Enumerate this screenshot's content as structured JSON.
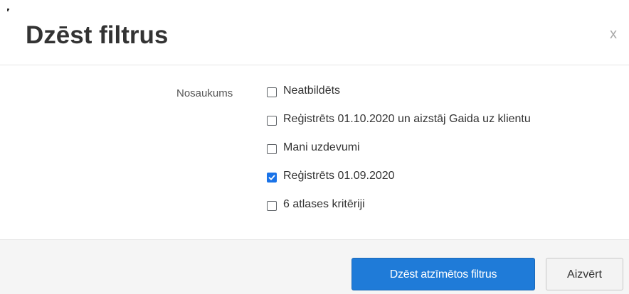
{
  "dialog": {
    "title": "Dzēst filtrus",
    "close_label": "x"
  },
  "form": {
    "field_label": "Nosaukums",
    "options": [
      {
        "label": "Neatbildēts",
        "checked": false
      },
      {
        "label": "Reģistrēts 01.10.2020 un aizstāj Gaida uz klientu",
        "checked": false
      },
      {
        "label": "Mani uzdevumi",
        "checked": false
      },
      {
        "label": "Reģistrēts 01.09.2020",
        "checked": true
      },
      {
        "label": "6 atlases kritēriji",
        "checked": false
      }
    ]
  },
  "footer": {
    "delete_label": "Dzēst atzīmētos filtrus",
    "close_label": "Aizvērt"
  },
  "colors": {
    "primary": "#1f7bd8",
    "checkbox_checked": "#1a73e8"
  }
}
